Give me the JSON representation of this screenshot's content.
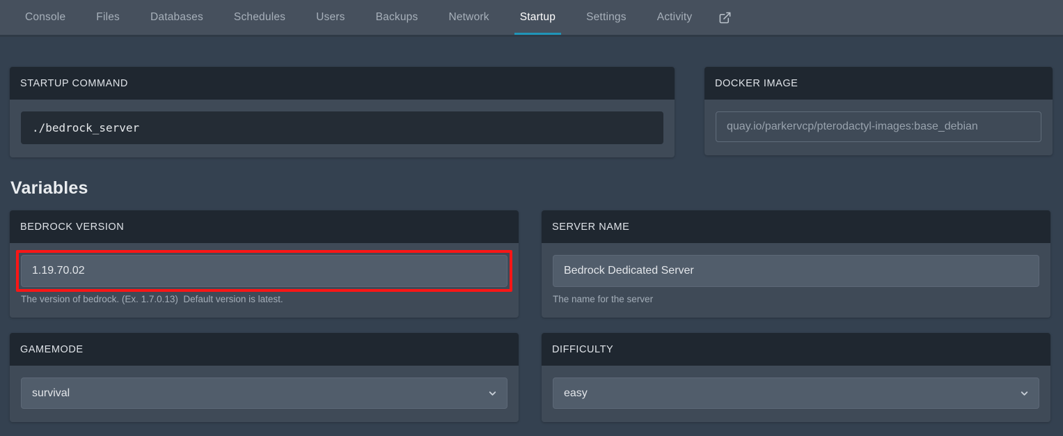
{
  "nav": {
    "items": [
      {
        "label": "Console",
        "active": false
      },
      {
        "label": "Files",
        "active": false
      },
      {
        "label": "Databases",
        "active": false
      },
      {
        "label": "Schedules",
        "active": false
      },
      {
        "label": "Users",
        "active": false
      },
      {
        "label": "Backups",
        "active": false
      },
      {
        "label": "Network",
        "active": false
      },
      {
        "label": "Startup",
        "active": true
      },
      {
        "label": "Settings",
        "active": false
      },
      {
        "label": "Activity",
        "active": false
      }
    ],
    "external_link_icon": "external-link-icon",
    "active_underline_color": "#2095b8"
  },
  "startup_command": {
    "header": "STARTUP COMMAND",
    "value": "./bedrock_server"
  },
  "docker_image": {
    "header": "DOCKER IMAGE",
    "value": "quay.io/parkervcp/pterodactyl-images:base_debian"
  },
  "variables_section": {
    "title": "Variables",
    "items": [
      {
        "header": "BEDROCK VERSION",
        "control": "text",
        "value": "1.19.70.02",
        "help": "The version of bedrock. (Ex. 1.7.0.13)  Default version is latest.",
        "highlighted": true
      },
      {
        "header": "SERVER NAME",
        "control": "text",
        "value": "Bedrock Dedicated Server",
        "help": "The name for the server",
        "highlighted": false
      },
      {
        "header": "GAMEMODE",
        "control": "select",
        "value": "survival",
        "options": [
          "survival"
        ],
        "help": "",
        "highlighted": false
      },
      {
        "header": "DIFFICULTY",
        "control": "select",
        "value": "easy",
        "options": [
          "easy"
        ],
        "help": "",
        "highlighted": false
      }
    ]
  },
  "annotation": {
    "color": "#fb1616",
    "target": "bedrock-version-input"
  }
}
